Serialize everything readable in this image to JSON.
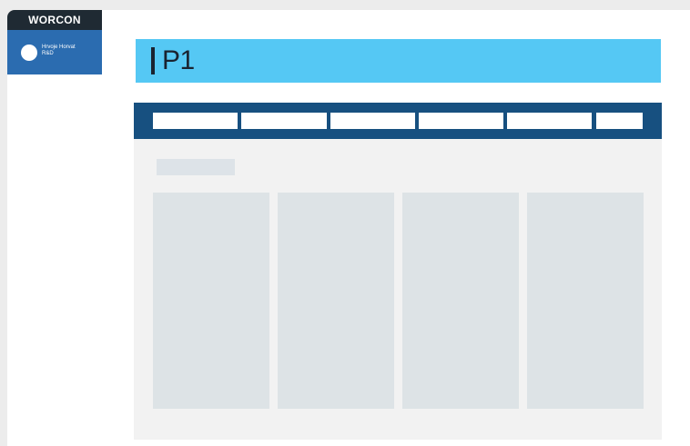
{
  "brand": {
    "logo_text": "WORCON"
  },
  "user": {
    "name": "Hrvoje Horvat",
    "department": "R&D"
  },
  "page": {
    "title": "P1"
  },
  "tabs": [
    {
      "label": ""
    },
    {
      "label": ""
    },
    {
      "label": ""
    },
    {
      "label": ""
    },
    {
      "label": ""
    },
    {
      "label": ""
    }
  ],
  "section": {
    "label": ""
  },
  "cards": [
    {
      "content": ""
    },
    {
      "content": ""
    },
    {
      "content": ""
    },
    {
      "content": ""
    }
  ],
  "colors": {
    "logo_bar": "#1f2a33",
    "user_card": "#2b6cb0",
    "title_banner": "#55c8f4",
    "tabs_bar": "#175080",
    "content_bg": "#f2f2f2",
    "placeholder": "#dde3e6"
  }
}
